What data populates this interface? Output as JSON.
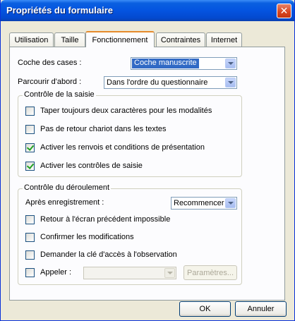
{
  "window": {
    "title": "Propriétés du formulaire"
  },
  "tabs": [
    {
      "label": "Utilisation"
    },
    {
      "label": "Taille"
    },
    {
      "label": "Fonctionnement",
      "active": true
    },
    {
      "label": "Contraintes"
    },
    {
      "label": "Internet"
    }
  ],
  "fields": {
    "coche_label": "Coche des cases :",
    "coche_value": "Coche manuscrite",
    "parcourir_label": "Parcourir d'abord :",
    "parcourir_value": "Dans l'ordre du questionnaire"
  },
  "group_saisie": {
    "title": "Contrôle de la saisie",
    "options": [
      {
        "label": "Taper toujours deux caractères pour les modalités",
        "checked": false
      },
      {
        "label": "Pas de retour chariot dans les textes",
        "checked": false
      },
      {
        "label": "Activer les renvois et conditions de présentation",
        "checked": true
      },
      {
        "label": "Activer les contrôles de saisie",
        "checked": true
      }
    ]
  },
  "group_deroulement": {
    "title": "Contrôle du déroulement",
    "apres_label": "Après enregistrement :",
    "apres_value": "Recommencer",
    "options": [
      {
        "label": "Retour à l'écran précédent impossible",
        "checked": false
      },
      {
        "label": "Confirmer les modifications",
        "checked": false
      },
      {
        "label": "Demander la clé d'accès à l'observation",
        "checked": false
      }
    ],
    "appeler_label": "Appeler :",
    "appeler_checked": false,
    "appeler_value": "",
    "parametres_label": "Paramètres..."
  },
  "buttons": {
    "ok": "OK",
    "cancel": "Annuler"
  },
  "colors": {
    "titlebar": "#0454e0",
    "selection": "#316ac5",
    "active_tab_accent": "#e68b2c",
    "check": "#21a121"
  },
  "icons": {
    "close": "close-icon",
    "dropdown": "chevron-down-icon",
    "check": "checkmark-icon"
  }
}
